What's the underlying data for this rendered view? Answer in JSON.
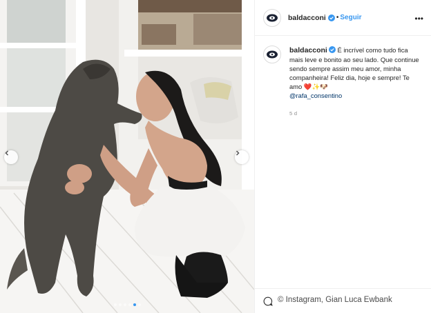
{
  "post": {
    "username": "baldacconi",
    "separator": "•",
    "follow_label": "Seguir",
    "more_label": "•••",
    "caption": {
      "username": "baldacconi",
      "text": " É incrível como tudo fica mais leve e bonito ao seu lado. Que continue sendo sempre assim meu amor, minha companheira! Feliz dia, hoje e sempre! Te amo ",
      "emojis": "❤️✨🐶",
      "mention": "@rafa_consentino"
    },
    "time_ago": "5 d"
  },
  "photo": {
    "slides_total": 6,
    "active_slide": 5
  },
  "credit": "© Instagram, Gian Luca Ewbank",
  "colors": {
    "link_blue": "#3897f0",
    "mention_blue": "#003569",
    "verified_blue": "#3897f0"
  },
  "icons": [
    "chevron-left-icon",
    "chevron-right-icon",
    "verified-icon",
    "more-icon",
    "comment-icon",
    "avatar-logo-icon"
  ]
}
